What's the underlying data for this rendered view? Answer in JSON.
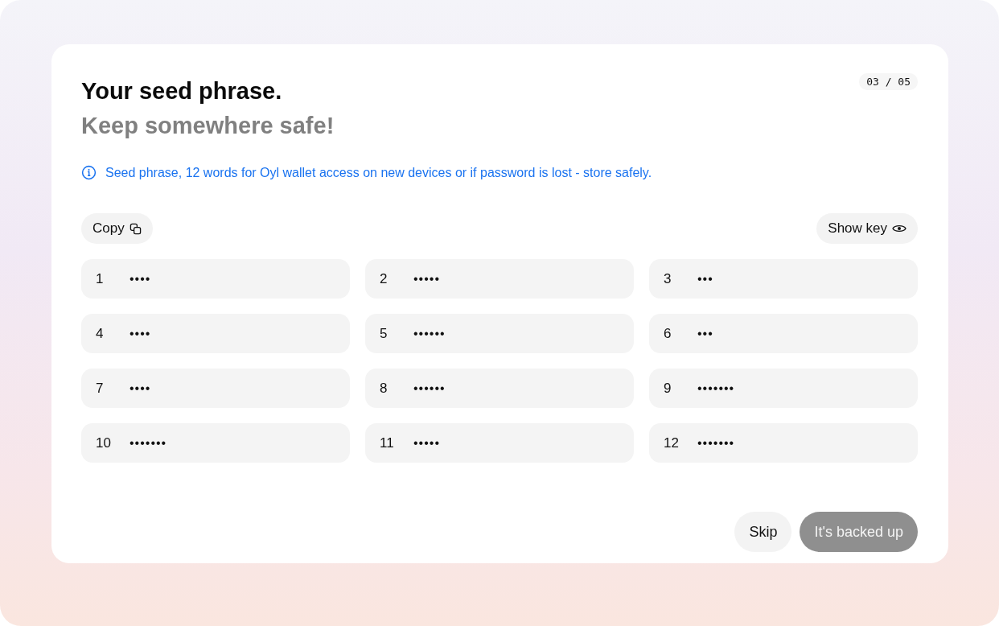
{
  "step": "03 / 05",
  "title": "Your seed phrase.",
  "subtitle": "Keep somewhere safe!",
  "info": "Seed phrase, 12 words for Oyl wallet access on new devices or if password is lost - store safely.",
  "copy_button": "Copy",
  "show_key_button": "Show key",
  "words": [
    {
      "index": "1",
      "word": "••••"
    },
    {
      "index": "2",
      "word": "•••••"
    },
    {
      "index": "3",
      "word": "•••"
    },
    {
      "index": "4",
      "word": "••••"
    },
    {
      "index": "5",
      "word": "••••••"
    },
    {
      "index": "6",
      "word": "•••"
    },
    {
      "index": "7",
      "word": "••••"
    },
    {
      "index": "8",
      "word": "••••••"
    },
    {
      "index": "9",
      "word": "•••••••"
    },
    {
      "index": "10",
      "word": "•••••••"
    },
    {
      "index": "11",
      "word": "•••••"
    },
    {
      "index": "12",
      "word": "•••••••"
    }
  ],
  "skip_button": "Skip",
  "confirm_button": {
    "label": "It's backed up",
    "disabled": true
  }
}
